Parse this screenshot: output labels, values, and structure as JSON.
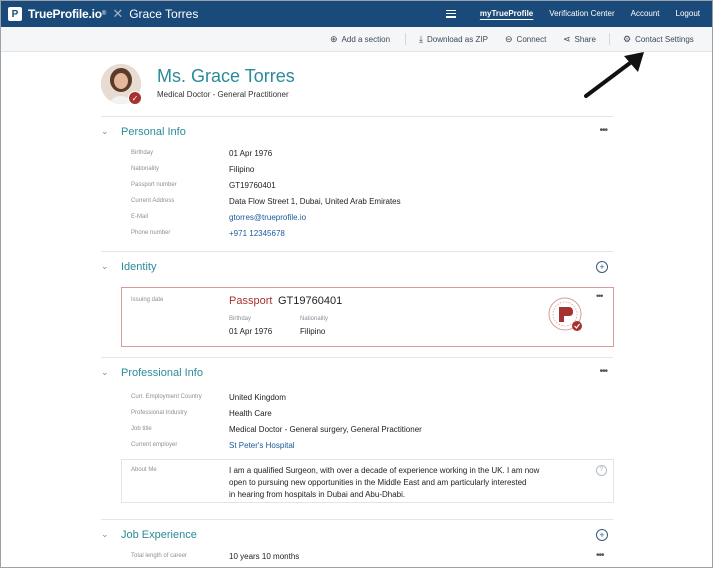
{
  "brand": {
    "name": "TrueProfile.io",
    "superscript": "®",
    "logo_letter": "P",
    "user": "Grace Torres"
  },
  "nav": {
    "items": [
      "myTrueProfile",
      "Verification Center",
      "Account",
      "Logout"
    ],
    "active": "myTrueProfile"
  },
  "toolbar": {
    "add_section": "Add a section",
    "download": "Download as ZIP",
    "connect": "Connect",
    "share": "Share",
    "contact_settings": "Contact Settings"
  },
  "profile": {
    "name": "Ms. Grace Torres",
    "subtitle": "Medical Doctor - General Practitioner"
  },
  "personal_info": {
    "title": "Personal Info",
    "rows": [
      {
        "label": "Birthday",
        "value": "01 Apr 1976"
      },
      {
        "label": "Nationality",
        "value": "Filipino"
      },
      {
        "label": "Passport number",
        "value": "GT19760401"
      },
      {
        "label": "Current Address",
        "value": "Data Flow Street 1, Dubai, United Arab Emirates"
      },
      {
        "label": "E-Mail",
        "value": "gtorres@trueprofile.io"
      },
      {
        "label": "Phone number",
        "value": "+971 12345678"
      }
    ]
  },
  "identity": {
    "title": "Identity",
    "issuing_label": "Issuing date",
    "doc_type": "Passport",
    "doc_number": "GT19760401",
    "birthday_label": "Birthday",
    "birthday": "01 Apr 1976",
    "nationality_label": "Nationality",
    "nationality": "Filipino"
  },
  "professional_info": {
    "title": "Professional Info",
    "rows": [
      {
        "label": "Curr. Employment Country",
        "value": "United Kingdom"
      },
      {
        "label": "Professional Industry",
        "value": "Health Care"
      },
      {
        "label": "Job title",
        "value": "Medical Doctor - General surgery, General Practitioner"
      },
      {
        "label": "Current employer",
        "value": "St Peter's Hospital"
      }
    ],
    "about_label": "About Me",
    "about_lines": [
      "I am a qualified Surgeon, with over a decade of experience working in the UK. I am now",
      "open to pursuing new opportunities in the Middle East and am particularly interested",
      "in hearing from hospitals in Dubai and Abu-Dhabi."
    ]
  },
  "job_experience": {
    "title": "Job Experience",
    "rows": [
      {
        "label": "Total length of career",
        "value": "10 years 10 months"
      }
    ]
  },
  "colors": {
    "header": "#1a4a7a",
    "accent": "#2a8a9a",
    "verified": "#a5322f"
  },
  "icons": [
    "hamburger-icon",
    "add-circle-icon",
    "download-icon",
    "connect-icon",
    "share-icon",
    "gear-icon",
    "chevron-down-icon",
    "more-dots-icon",
    "verified-check-icon",
    "seal-icon",
    "help-icon"
  ]
}
